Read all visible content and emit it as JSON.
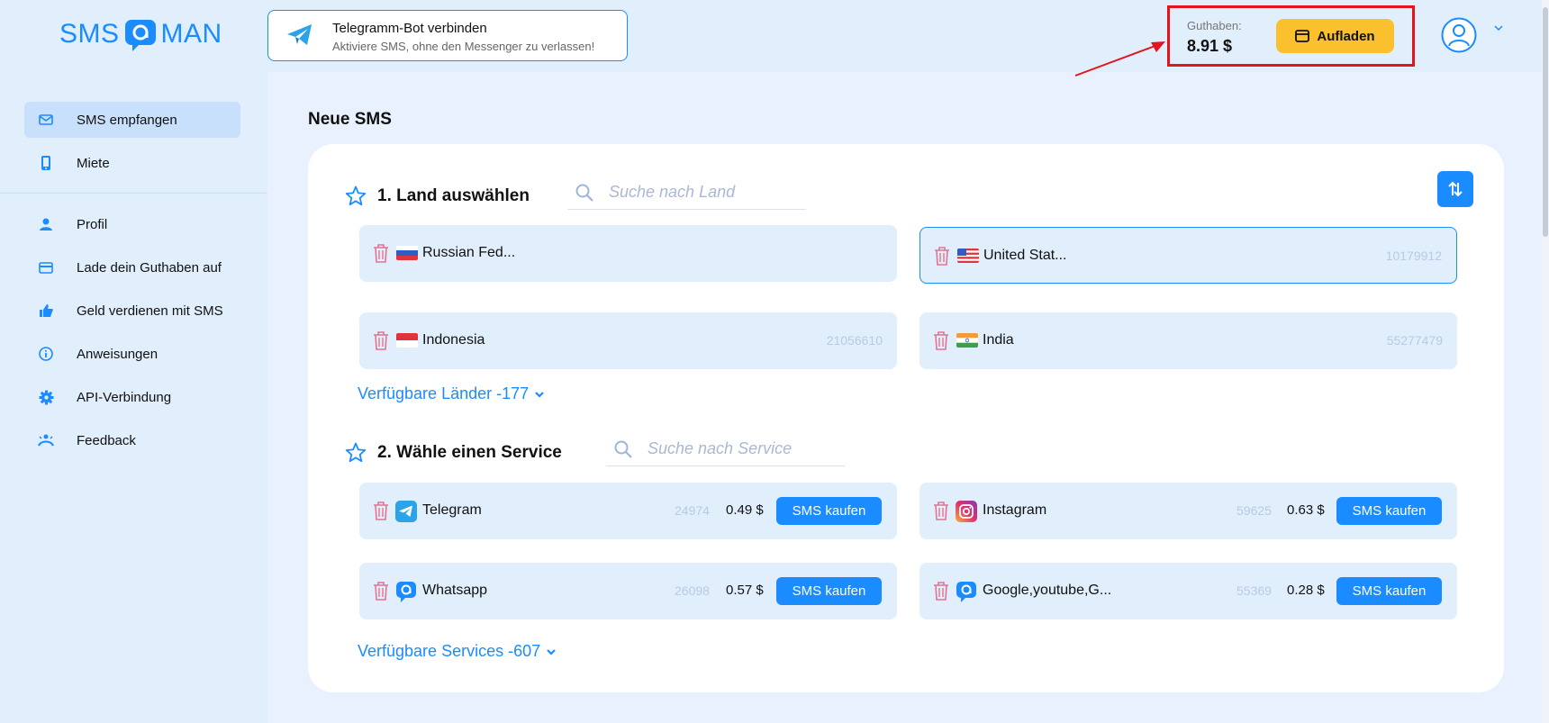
{
  "brand": {
    "left": "SMS",
    "right": "MAN"
  },
  "banner": {
    "title": "Telegramm-Bot verbinden",
    "subtitle": "Aktiviere SMS, ohne den Messenger zu verlassen!"
  },
  "balance": {
    "label": "Guthaben:",
    "value": "8.91 $",
    "topup_label": "Aufladen"
  },
  "sidebar": {
    "items": [
      {
        "label": "SMS empfangen",
        "icon": "mail-icon",
        "active": true
      },
      {
        "label": "Miete",
        "icon": "phone-icon"
      },
      {
        "label": "Profil",
        "icon": "user-icon"
      },
      {
        "label": "Lade dein Guthaben auf",
        "icon": "card-icon"
      },
      {
        "label": "Geld verdienen mit SMS",
        "icon": "thumbs-up-icon"
      },
      {
        "label": "Anweisungen",
        "icon": "info-icon"
      },
      {
        "label": "API-Verbindung",
        "icon": "gear-icon"
      },
      {
        "label": "Feedback",
        "icon": "feedback-icon"
      }
    ]
  },
  "main": {
    "title": "Neue SMS",
    "country_section": {
      "title": "1. Land auswählen",
      "search_placeholder": "Suche nach Land",
      "countries": [
        {
          "name": "Russian Fed...",
          "count": ""
        },
        {
          "name": "United Stat...",
          "count": "10179912",
          "selected": true
        },
        {
          "name": "Indonesia",
          "count": "21056610"
        },
        {
          "name": "India",
          "count": "55277479"
        }
      ],
      "more_label": "Verfügbare Länder -177"
    },
    "service_section": {
      "title": "2. Wähle einen Service",
      "search_placeholder": "Suche nach Service",
      "services": [
        {
          "name": "Telegram",
          "count": "24974",
          "price": "0.49 $",
          "buy_label": "SMS kaufen"
        },
        {
          "name": "Instagram",
          "count": "59625",
          "price": "0.63 $",
          "buy_label": "SMS kaufen"
        },
        {
          "name": "Whatsapp",
          "count": "26098",
          "price": "0.57 $",
          "buy_label": "SMS kaufen"
        },
        {
          "name": "Google,youtube,G...",
          "count": "55369",
          "price": "0.28 $",
          "buy_label": "SMS kaufen"
        }
      ],
      "more_label": "Verfügbare Services -607"
    }
  },
  "colors": {
    "accent": "#1a8cff",
    "topup": "#fbc02d",
    "highlight": "#e3141b",
    "trash": "#e57390"
  }
}
